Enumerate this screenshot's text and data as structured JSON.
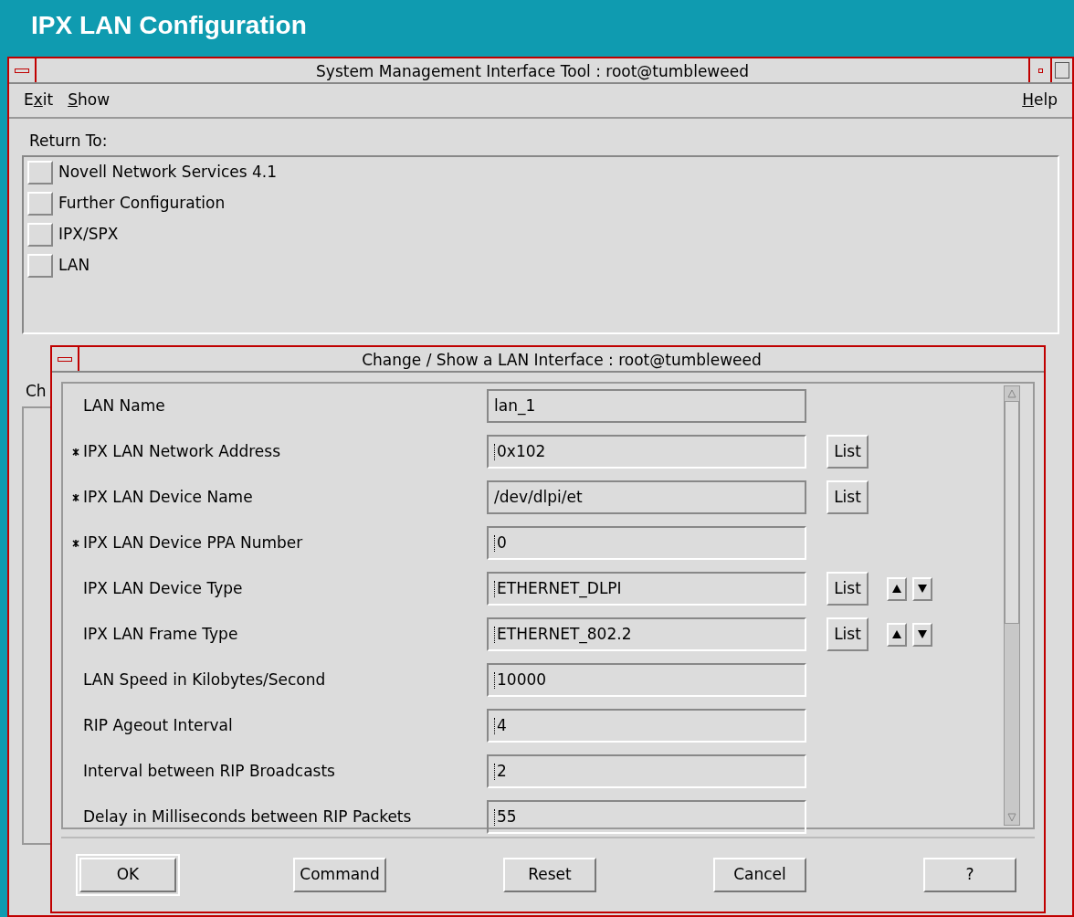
{
  "banner": {
    "title": "IPX LAN Configuration"
  },
  "main_window": {
    "title": "System Management Interface Tool : root@tumbleweed",
    "menus": [
      {
        "before": "E",
        "key": "x",
        "after": "it"
      },
      {
        "key": "S",
        "after": "how"
      }
    ],
    "help_menu": {
      "key": "H",
      "after": "elp"
    },
    "return_label": "Return To:",
    "return_items": [
      {
        "label": "Novell Network Services 4.1"
      },
      {
        "label": "Further Configuration"
      },
      {
        "label": "IPX/SPX"
      },
      {
        "label": "LAN"
      }
    ],
    "hidden_label": "Ch"
  },
  "dialog": {
    "title": "Change / Show a LAN Interface : root@tumbleweed",
    "fields": [
      {
        "label": "LAN Name",
        "required": false,
        "value": "lan_1",
        "editable": false
      },
      {
        "label": "IPX LAN Network Address",
        "required": true,
        "value": "0x102",
        "editable": true,
        "list": "List"
      },
      {
        "label": "IPX LAN Device Name",
        "required": true,
        "value": "/dev/dlpi/et",
        "editable": false,
        "list": "List"
      },
      {
        "label": "IPX LAN Device PPA Number",
        "required": true,
        "value": "0",
        "editable": true
      },
      {
        "label": "IPX LAN Device Type",
        "required": false,
        "value": "ETHERNET_DLPI",
        "editable": true,
        "list": "List",
        "spin": true
      },
      {
        "label": "IPX LAN Frame Type",
        "required": false,
        "value": "ETHERNET_802.2",
        "editable": true,
        "list": "List",
        "spin": true
      },
      {
        "label": "LAN Speed in Kilobytes/Second",
        "required": false,
        "value": "10000",
        "editable": true
      },
      {
        "label": "RIP Ageout Interval",
        "required": false,
        "value": "4",
        "editable": true
      },
      {
        "label": "Interval between RIP Broadcasts",
        "required": false,
        "value": "2",
        "editable": true
      },
      {
        "label": "Delay in Milliseconds between RIP Packets",
        "required": false,
        "value": "55",
        "editable": true
      }
    ],
    "buttons": [
      {
        "label": "OK",
        "default": true
      },
      {
        "label": "Command",
        "default": false
      },
      {
        "label": "Reset",
        "default": false
      },
      {
        "label": "Cancel",
        "default": false
      },
      {
        "label": "?",
        "default": false
      }
    ]
  }
}
